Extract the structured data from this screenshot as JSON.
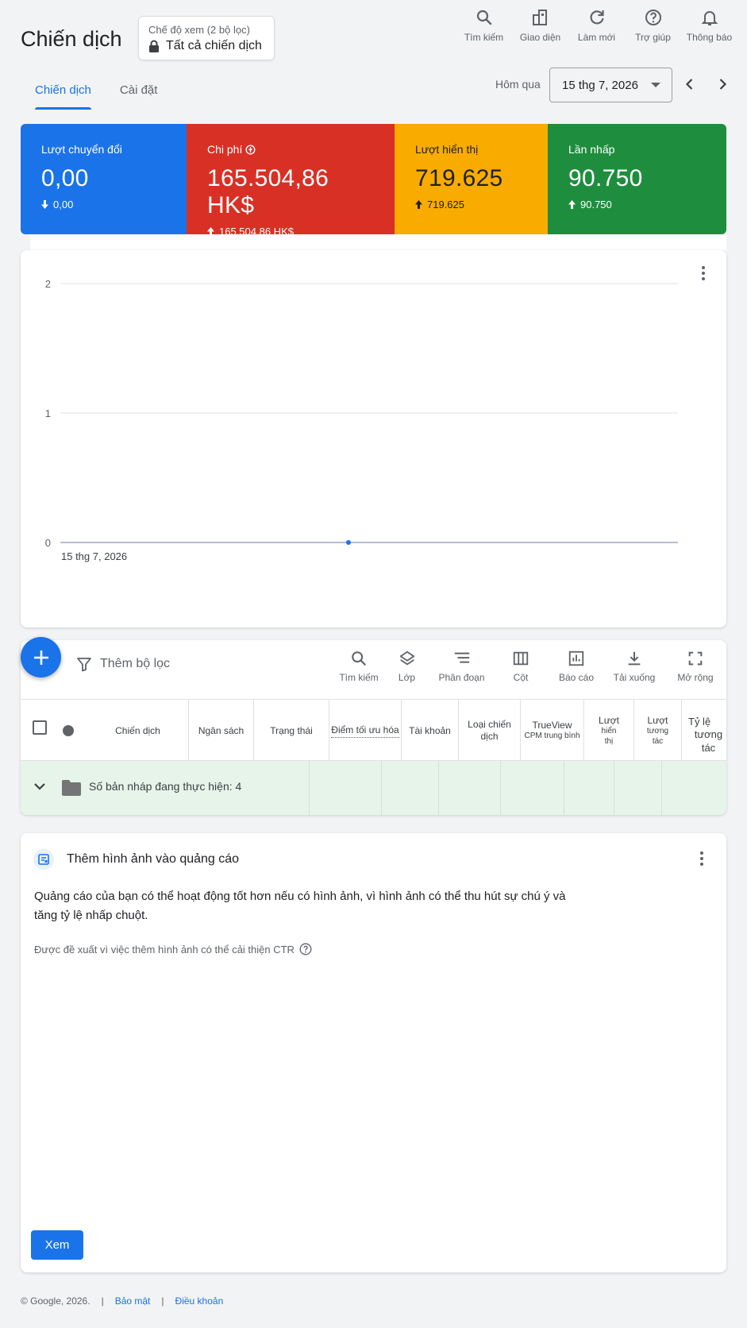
{
  "header": {
    "title": "Chiến dịch",
    "view_label": "Chế độ xem (2 bộ lọc)",
    "view_value": "Tất cả chiến dịch",
    "actions": [
      {
        "label": "Tìm kiếm",
        "icon": "search-icon"
      },
      {
        "label": "Giao diện",
        "icon": "appearance-icon"
      },
      {
        "label": "Làm mới",
        "icon": "refresh-icon"
      },
      {
        "label": "Trợ giúp",
        "icon": "help-icon"
      },
      {
        "label": "Thông báo",
        "icon": "bell-icon"
      }
    ]
  },
  "tabs": [
    {
      "label": "Chiến dịch",
      "active": true
    },
    {
      "label": "Cài đặt",
      "active": false
    }
  ],
  "date": {
    "label": "Hôm qua",
    "value": "15 thg 7, 2026"
  },
  "scorecards": [
    {
      "label": "Lượt chuyển đổi",
      "value": "0,00",
      "delta": "0,00",
      "direction": "down",
      "color": "#1a73e8"
    },
    {
      "label": "Chi phí",
      "value": "165.504,86 HK$",
      "delta": "165.504,86 HK$",
      "direction": "up",
      "color": "#d93025"
    },
    {
      "label": "Lượt hiển thị",
      "value": "719.625",
      "delta": "719.625",
      "direction": "up",
      "color": "#f9ab00"
    },
    {
      "label": "Lần nhấp",
      "value": "90.750",
      "delta": "90.750",
      "direction": "up",
      "color": "#1e8e3e"
    }
  ],
  "chart_data": {
    "type": "line",
    "x": [
      "15 thg 7, 2026"
    ],
    "y_ticks": [
      "2",
      "1",
      "0"
    ],
    "ylim": [
      0,
      2
    ],
    "series": [
      {
        "values": [
          0
        ],
        "color": "#1a73e8"
      }
    ],
    "x_tick_labels": [
      "15 thg 7, 2026"
    ],
    "grid": true
  },
  "table": {
    "filter_label": "Thêm bộ lọc",
    "tools": [
      {
        "label": "Tìm kiếm",
        "icon": "search-icon"
      },
      {
        "label": "Lớp",
        "icon": "layers-icon"
      },
      {
        "label": "Phân đoạn",
        "icon": "segment-icon"
      },
      {
        "label": "Cột",
        "icon": "columns-icon"
      },
      {
        "label": "Báo cáo",
        "icon": "report-icon"
      },
      {
        "label": "Tải xuống",
        "icon": "download-icon"
      },
      {
        "label": "Mở rộng",
        "icon": "expand-icon"
      }
    ],
    "columns": {
      "campaign": "Chiến dịch",
      "budget": "Ngân sách",
      "status": "Trạng thái",
      "opt_score": "Điểm tối ưu hóa",
      "account": "Tài khoản",
      "campaign_type_1": "Loại chiến",
      "campaign_type_2": "dịch",
      "trueview_1": "TrueView",
      "trueview_2": "CPM trung bình",
      "impressions_1": "Lượt",
      "impressions_2": "hiển",
      "impressions_3": "thị",
      "interactions_1": "Lượt",
      "interactions_2": "tương",
      "interactions_3": "tác",
      "rate_1": "Tỷ lệ",
      "rate_2": "tương tác"
    },
    "draft_row": "Số bản nháp đang thực hiện: 4"
  },
  "recommendation": {
    "title": "Thêm hình ảnh vào quảng cáo",
    "body": "Quảng cáo của bạn có thể hoạt động tốt hơn nếu có hình ảnh, vì hình ảnh có thể thu hút sự chú ý và tăng tỷ lệ nhấp chuột.",
    "note": "Được đề xuất vì việc thêm hình ảnh có thể cải thiện CTR",
    "button": "Xem"
  },
  "footer": {
    "copyright": "© Google, 2026.",
    "sep": "|",
    "privacy": "Bảo mật",
    "terms": "Điều khoản"
  }
}
